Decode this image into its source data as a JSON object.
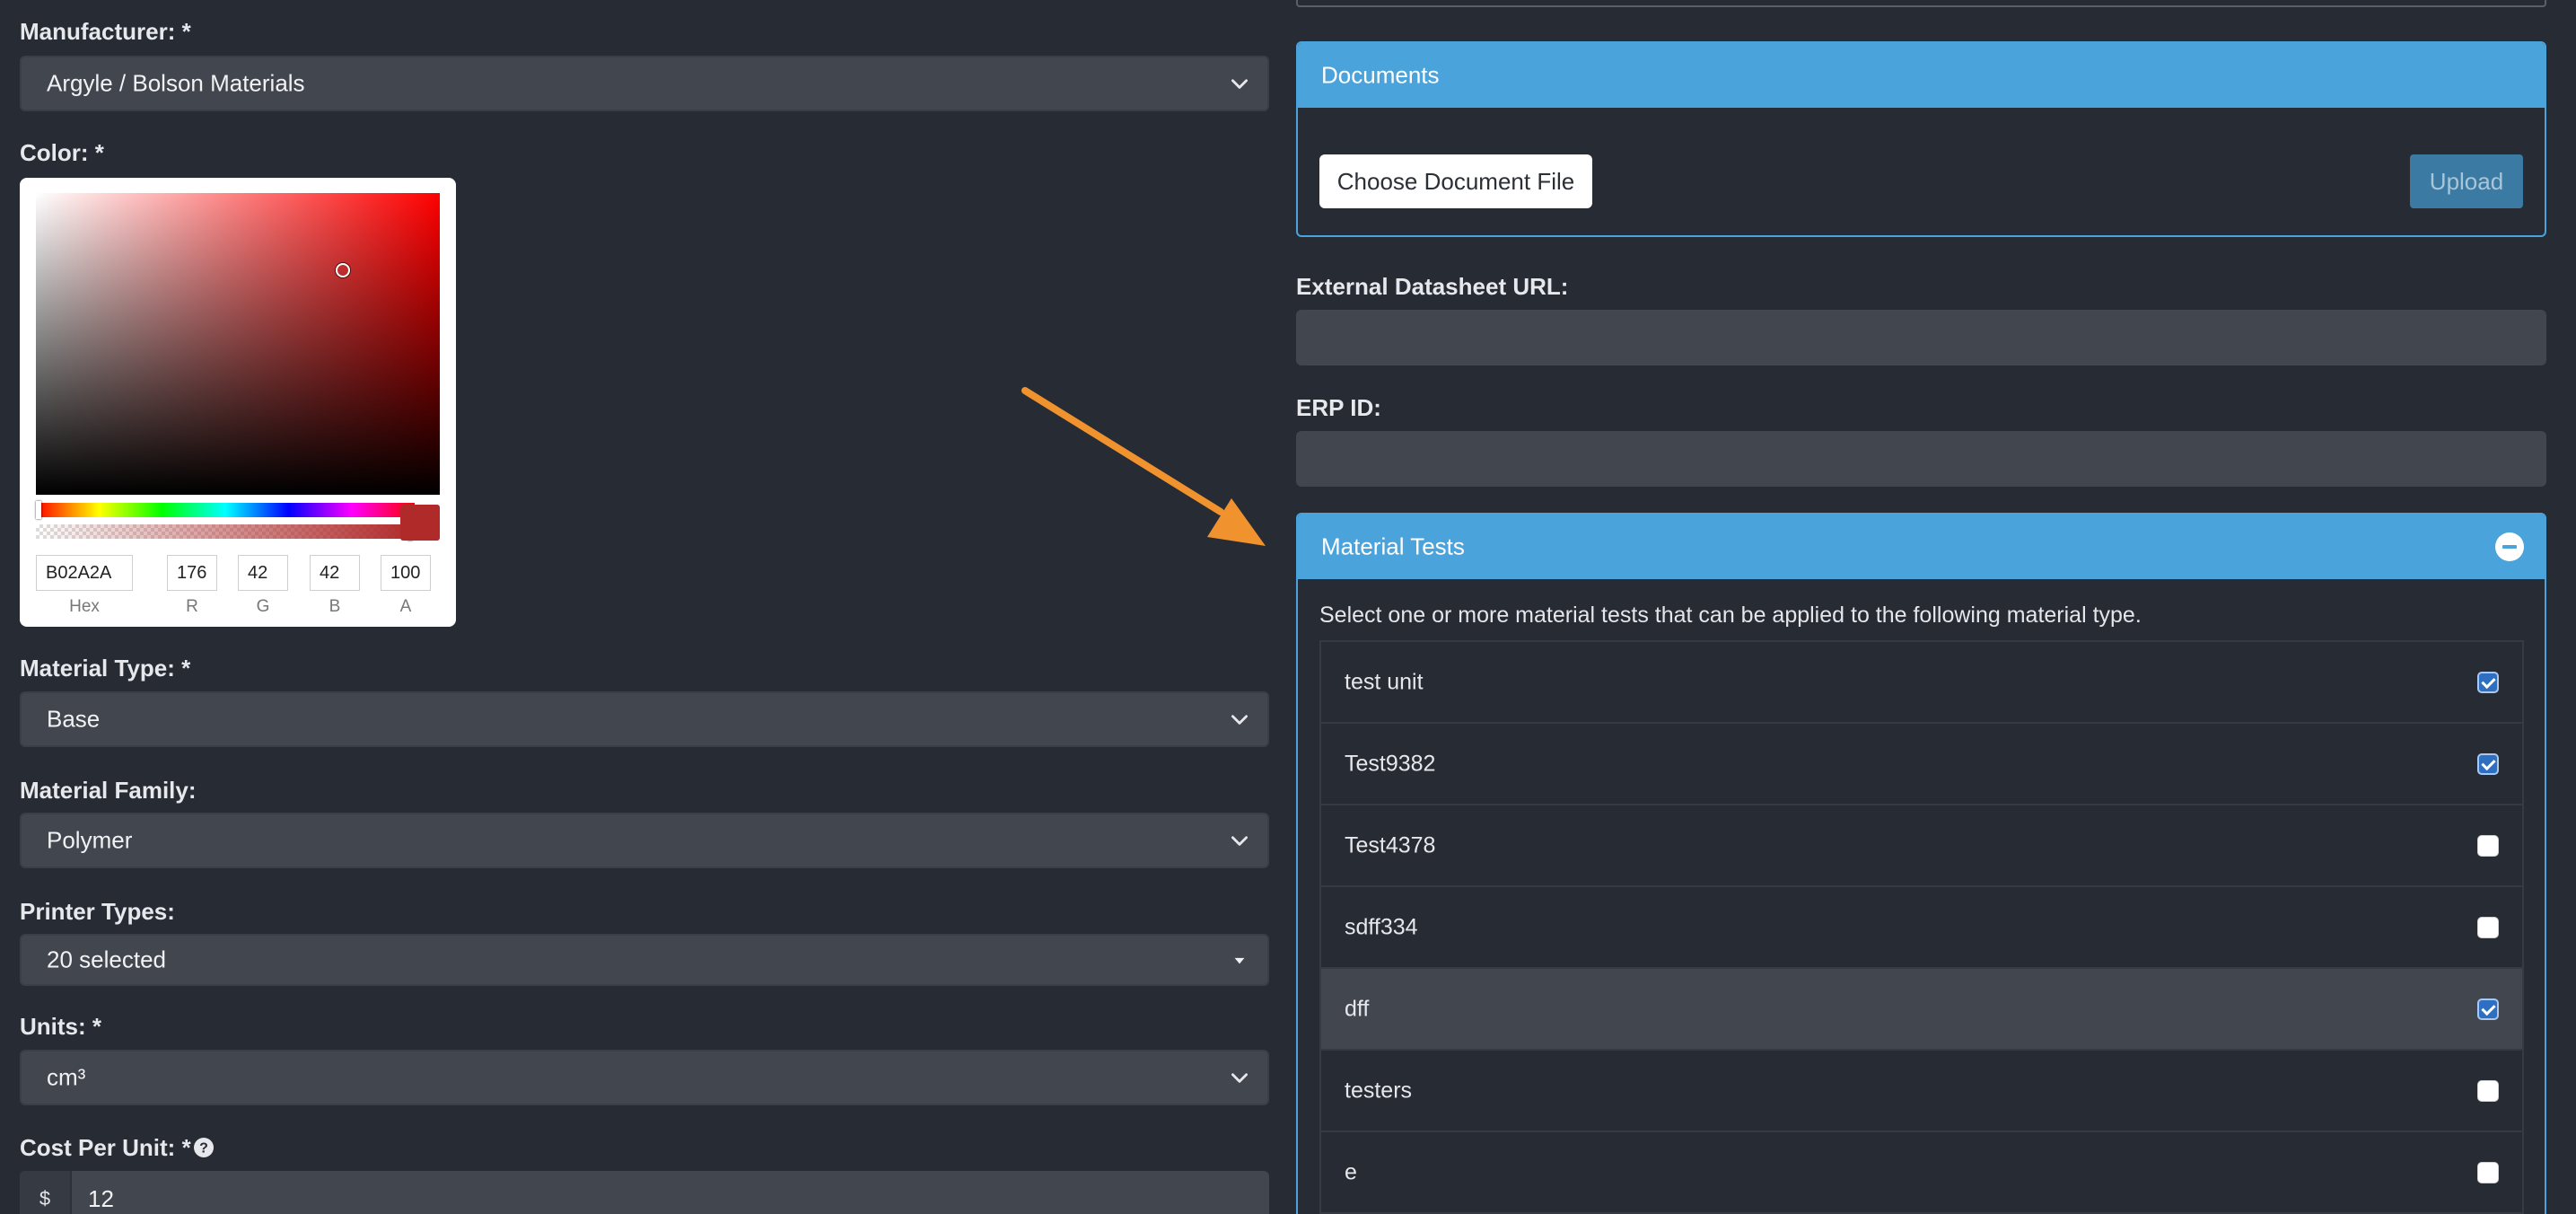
{
  "form": {
    "manufacturer": {
      "label": "Manufacturer: *",
      "value": "Argyle / Bolson Materials"
    },
    "color": {
      "label": "Color: *",
      "picker": {
        "hex": "B02A2A",
        "r": "176",
        "g": "42",
        "b": "42",
        "a": "100",
        "labels": {
          "hex": "Hex",
          "r": "R",
          "g": "G",
          "b": "B",
          "a": "A"
        },
        "swatch_color": "#b02a2a"
      }
    },
    "material_type": {
      "label": "Material Type: *",
      "value": "Base"
    },
    "material_family": {
      "label": "Material Family:",
      "value": "Polymer"
    },
    "printer_types": {
      "label": "Printer Types:",
      "value": "20 selected"
    },
    "units": {
      "label": "Units: *",
      "value": "cm³"
    },
    "cost_per_unit": {
      "label": "Cost Per Unit: *",
      "prefix": "$",
      "value": "12"
    }
  },
  "documents": {
    "title": "Documents",
    "choose_label": "Choose Document File",
    "upload_label": "Upload"
  },
  "external_datasheet": {
    "label": "External Datasheet URL:",
    "value": ""
  },
  "erp_id": {
    "label": "ERP ID:",
    "value": ""
  },
  "material_tests": {
    "title": "Material Tests",
    "description": "Select one or more material tests that can be applied to the following material type.",
    "items": [
      {
        "name": "test unit",
        "checked": true
      },
      {
        "name": "Test9382",
        "checked": true
      },
      {
        "name": "Test4378",
        "checked": false
      },
      {
        "name": "sdff334",
        "checked": false
      },
      {
        "name": "dff",
        "checked": true,
        "highlighted": true
      },
      {
        "name": "testers",
        "checked": false
      },
      {
        "name": "e",
        "checked": false
      }
    ]
  },
  "colors": {
    "background": "#272b34",
    "input_bg": "#42464f",
    "panel_accent": "#4aa3db",
    "arrow": "#f0922e",
    "checkbox_on": "#2f6fc2"
  }
}
